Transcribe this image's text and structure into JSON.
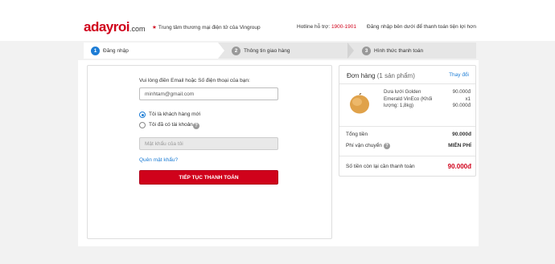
{
  "header": {
    "logo_main": "adayroi",
    "logo_suffix": ".com",
    "tagline": "Trung tâm thương mại điện tử của Vingroup",
    "hotline_label": "Hotline hỗ trợ:",
    "hotline_number": "1900-1901",
    "login_hint": "Đăng nhập bên dưới để thanh toán tiện lợi hơn"
  },
  "steps": [
    {
      "num": "1",
      "label": "Đăng nhập",
      "active": true
    },
    {
      "num": "2",
      "label": "Thông tin giao hàng",
      "active": false
    },
    {
      "num": "3",
      "label": "Hình thức thanh toán",
      "active": false
    }
  ],
  "login": {
    "prompt": "Vui lòng điền Email hoặc Số điện thoại của bạn:",
    "email_value": "minhtam@gmail.com",
    "option_new": "Tôi là khách hàng mới",
    "option_existing": "Tôi đã có tài khoản",
    "selected_option": "new",
    "password_placeholder": "Mật khẩu của tôi",
    "forgot_label": "Quên mật khẩu?",
    "continue_label": "TIẾP TỤC THANH TOÁN"
  },
  "order": {
    "title": "Đơn hàng",
    "count_label": "(1 sản phẩm)",
    "change_label": "Thay đổi",
    "item": {
      "name": "Dưa lưới Golden Emerald VinEco (Khối lượng: 1,8kg)",
      "price": "90.000đ",
      "quantity": "x1",
      "line_total": "90.000đ"
    },
    "subtotal_label": "Tổng tiền",
    "subtotal_value": "90.000đ",
    "shipping_label": "Phí vận chuyển",
    "shipping_value": "MIỄN PHÍ",
    "remaining_label": "Số tiền còn lại cần thanh toán",
    "remaining_value": "90.000đ"
  },
  "colors": {
    "brand_red": "#d0021b",
    "link_blue": "#1c7cd5"
  }
}
